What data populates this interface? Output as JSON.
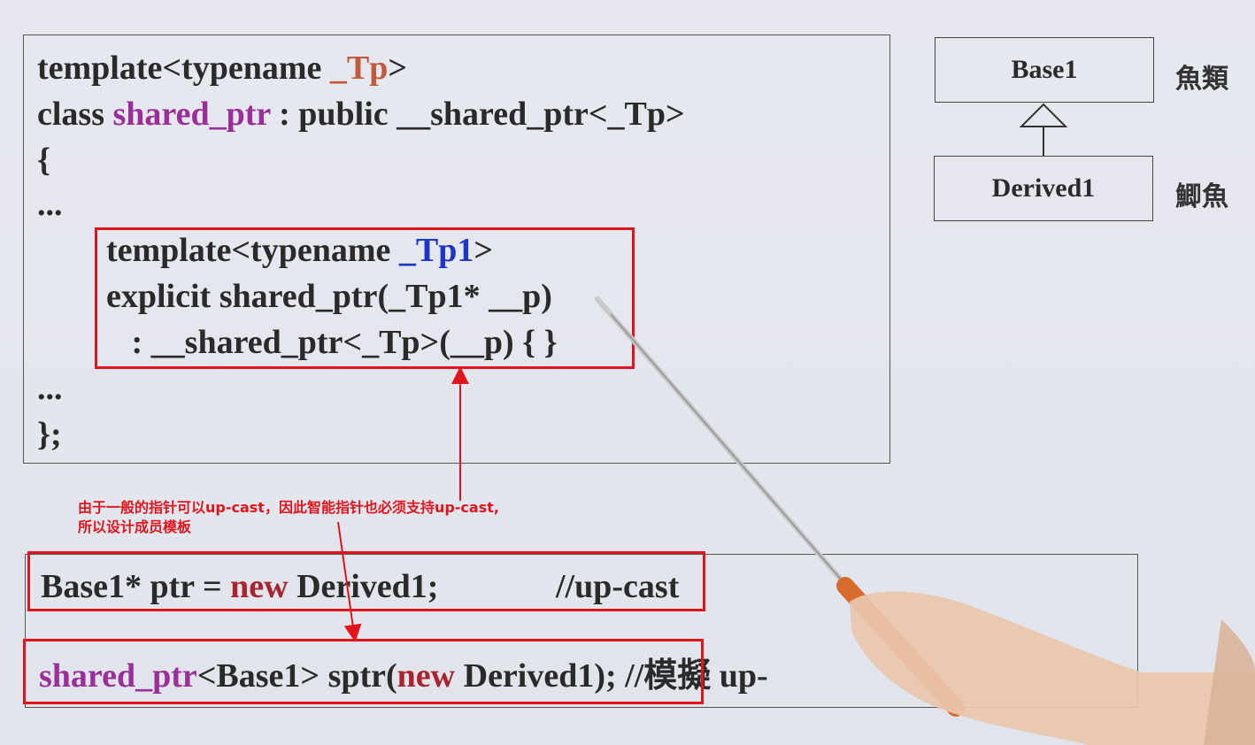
{
  "code_block": {
    "line1_prefix": "template<typename ",
    "line1_tp": "_Tp",
    "line1_suffix": ">",
    "line2_prefix": "class ",
    "line2_class": "shared_ptr",
    "line2_suffix": " : public __shared_ptr<_Tp>",
    "line3": "{",
    "line4": "...",
    "member_line1_prefix": "template<typename ",
    "member_line1_tp": "_Tp1",
    "member_line1_suffix": ">",
    "member_line2": "explicit shared_ptr(_Tp1* __p)",
    "member_line3": "   : __shared_ptr<_Tp>(__p) { }",
    "line8": "...",
    "line9": "};"
  },
  "uml": {
    "base_class": "Base1",
    "derived_class": "Derived1",
    "base_label": "魚類",
    "derived_label": "鯽魚"
  },
  "annotation": {
    "line1": "由于一般的指针可以up-cast，因此智能指针也必须支持up-cast,",
    "line2": "所以设计成员模板"
  },
  "examples": {
    "ex1_prefix": "Base1* ptr = ",
    "ex1_new": "new",
    "ex1_suffix": " Derived1;",
    "ex1_comment": "//up-cast",
    "ex2_class": "shared_ptr",
    "ex2_mid": "<Base1> sptr(",
    "ex2_new": "new",
    "ex2_suffix": " Derived1);",
    "ex2_comment": " //模擬 up-"
  },
  "colors": {
    "highlight_red": "#e0141c",
    "keyword_purple": "#9a2f9a",
    "keyword_blue": "#1f35c8",
    "keyword_red": "#a8252f"
  }
}
